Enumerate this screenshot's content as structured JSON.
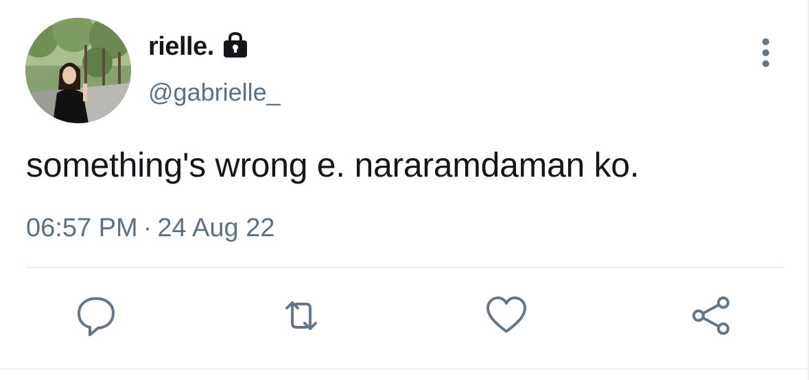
{
  "author": {
    "display_name": "rielle.",
    "handle": "@gabrielle_",
    "protected_icon": "lock-icon",
    "avatar_icon": "profile-photo"
  },
  "tweet": {
    "text": "something's wrong e. nararamdaman ko.",
    "time": "06:57 PM",
    "separator": "·",
    "date": "24 Aug 22"
  },
  "actions": [
    {
      "name": "reply",
      "icon": "comment-icon"
    },
    {
      "name": "retweet",
      "icon": "retweet-icon"
    },
    {
      "name": "like",
      "icon": "heart-icon"
    },
    {
      "name": "share",
      "icon": "share-icon"
    }
  ],
  "colors": {
    "primary_text": "#14171a",
    "secondary_text": "#5b7083",
    "icon": "#657786",
    "divider": "#e6ecf0"
  }
}
